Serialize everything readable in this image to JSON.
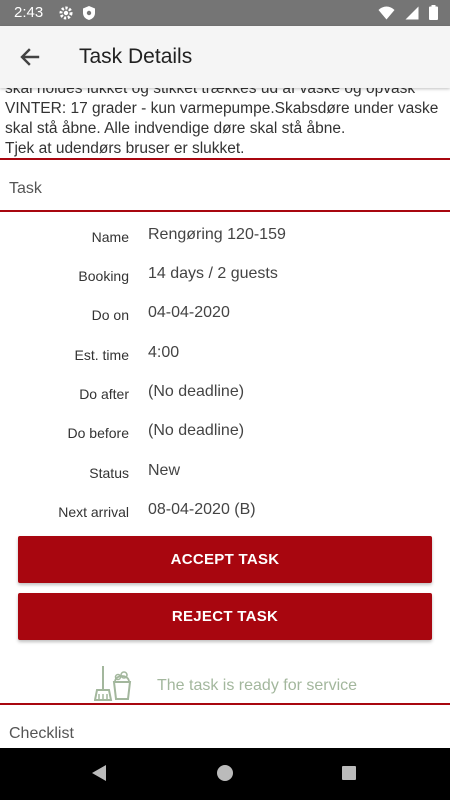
{
  "status_bar": {
    "time": "2:43",
    "icons": [
      "settings-icon",
      "shield-icon",
      "wifi-icon",
      "signal-icon",
      "battery-icon"
    ]
  },
  "app_bar": {
    "title": "Task Details",
    "back_icon": "arrow-back-icon"
  },
  "notes": {
    "text": "skal holdes lukket og stikket trækkes ud af vaske og opvask\nVINTER: 17 grader - kun varmepumpe.Skabsdøre under vaske skal stå åbne. Alle indvendige døre skal stå åbne.\nTjek at udendørs bruser er slukket."
  },
  "task_section": {
    "label": "Task",
    "rows": [
      {
        "label": "Name",
        "value": "Rengøring 120-159"
      },
      {
        "label": "Booking",
        "value": "14 days / 2 guests"
      },
      {
        "label": "Do on",
        "value": "04-04-2020"
      },
      {
        "label": "Est. time",
        "value": "4:00"
      },
      {
        "label": "Do after",
        "value": "(No deadline)"
      },
      {
        "label": "Do before",
        "value": "(No deadline)"
      },
      {
        "label": "Status",
        "value": "New"
      },
      {
        "label": "Next arrival",
        "value": "08-04-2020 (B)"
      }
    ]
  },
  "actions": {
    "accept_label": "ACCEPT TASK",
    "reject_label": "REJECT TASK"
  },
  "ready_notice": {
    "text": "The task is ready for service",
    "icon": "cleaning-bucket-icon"
  },
  "checklist_section": {
    "label": "Checklist"
  },
  "colors": {
    "accent": "#a8060f",
    "status_bar": "#757575",
    "ready_text": "#a3b79d"
  }
}
